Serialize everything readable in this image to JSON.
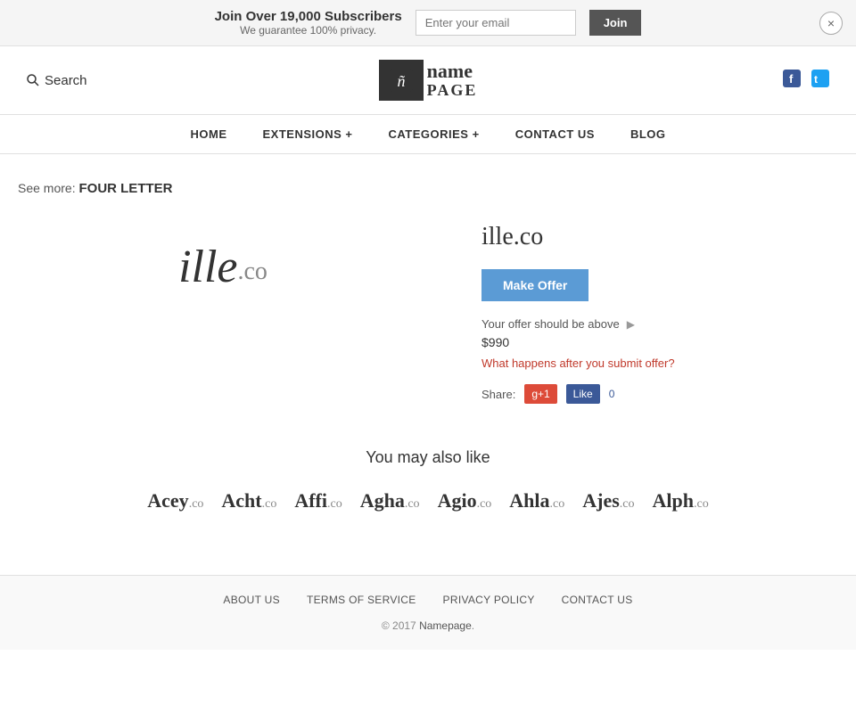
{
  "banner": {
    "main_text": "Join Over 19,000 Subscribers",
    "sub_text": "We guarantee 100% privacy.",
    "email_placeholder": "Enter your email",
    "join_label": "Join",
    "close_label": "×"
  },
  "header": {
    "search_label": "Search",
    "logo_icon": "ñ",
    "logo_name": "name",
    "logo_page": "PAGE",
    "facebook_label": "f",
    "twitter_label": "t"
  },
  "nav": {
    "items": [
      {
        "label": "HOME",
        "id": "home"
      },
      {
        "label": "EXTENSIONS +",
        "id": "extensions"
      },
      {
        "label": "CATEGORIES +",
        "id": "categories"
      },
      {
        "label": "CONTACT US",
        "id": "contact"
      },
      {
        "label": "BLOG",
        "id": "blog"
      }
    ]
  },
  "breadcrumb": {
    "prefix": "See more:",
    "label": "FOUR LETTER"
  },
  "domain": {
    "name": "ille",
    "tld": ".co",
    "full": "ille.co",
    "make_offer_label": "Make Offer",
    "offer_info": "Your offer should be above",
    "offer_price": "$990",
    "offer_link": "What happens after you submit offer?",
    "share_label": "Share:",
    "gplus_label": "g+1",
    "fb_label": "Like",
    "fb_count": "0"
  },
  "also_like": {
    "title": "You may also like",
    "items": [
      {
        "name": "Acey",
        "tld": ".co"
      },
      {
        "name": "Acht",
        "tld": ".co"
      },
      {
        "name": "Affi",
        "tld": ".co"
      },
      {
        "name": "Agha",
        "tld": ".co"
      },
      {
        "name": "Agio",
        "tld": ".co"
      },
      {
        "name": "Ahla",
        "tld": ".co"
      },
      {
        "name": "Ajes",
        "tld": ".co"
      },
      {
        "name": "Alph",
        "tld": ".co"
      }
    ]
  },
  "footer": {
    "links": [
      {
        "label": "ABOUT US",
        "id": "about"
      },
      {
        "label": "TERMS OF SERVICE",
        "id": "terms"
      },
      {
        "label": "PRIVACY POLICY",
        "id": "privacy"
      },
      {
        "label": "CONTACT US",
        "id": "contact"
      }
    ],
    "copy_prefix": "© 2017 ",
    "copy_brand": "Namepage",
    "copy_suffix": "."
  }
}
